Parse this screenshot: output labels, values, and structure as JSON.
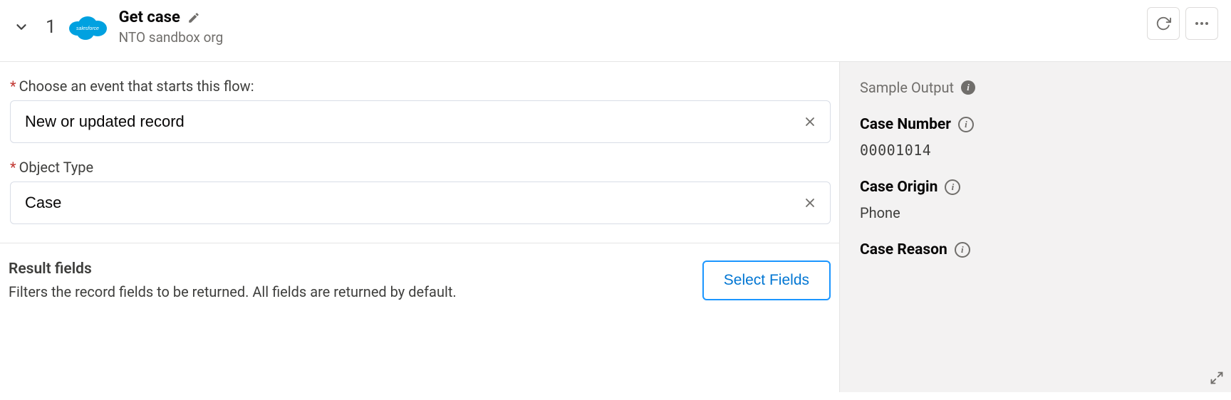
{
  "header": {
    "step_number": "1",
    "title": "Get case",
    "subtitle": "NTO sandbox org"
  },
  "form": {
    "event_label": "Choose an event that starts this flow:",
    "event_value": "New or updated record",
    "object_type_label": "Object Type",
    "object_type_value": "Case"
  },
  "result": {
    "title": "Result fields",
    "description": "Filters the record fields to be returned. All fields are returned by default.",
    "button_label": "Select Fields"
  },
  "sidebar": {
    "header": "Sample Output",
    "fields": [
      {
        "label": "Case Number",
        "value": "00001014",
        "mono": true
      },
      {
        "label": "Case Origin",
        "value": "Phone",
        "mono": false
      },
      {
        "label": "Case Reason",
        "value": "",
        "mono": false
      }
    ]
  }
}
